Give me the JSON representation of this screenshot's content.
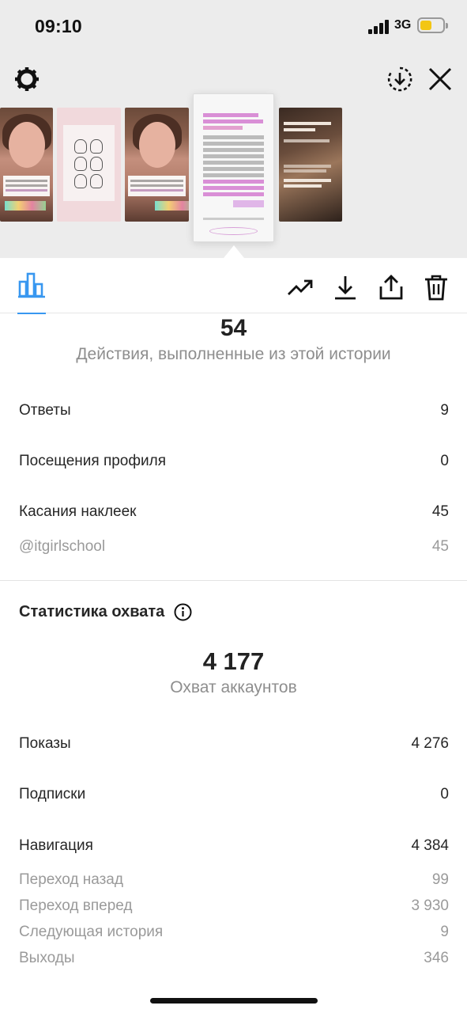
{
  "status_bar": {
    "time": "09:10",
    "network": "3G",
    "battery_level": 0.4,
    "battery_color": "#f3c614"
  },
  "top_bar": {
    "settings_icon": "gear-icon",
    "save_icon": "download-circle-icon",
    "close_icon": "close-icon"
  },
  "story_strip": {
    "selected_index": 3,
    "thumbnails": [
      {
        "kind": "face-photo"
      },
      {
        "kind": "drawings"
      },
      {
        "kind": "face-photo"
      },
      {
        "kind": "programming-text",
        "selected": true
      },
      {
        "kind": "dark-photo"
      }
    ]
  },
  "toolbar": {
    "active_tab_icon": "bar-chart-icon",
    "accent_color": "#3897f0",
    "actions": [
      "trending-up-icon",
      "download-icon",
      "share-icon",
      "trash-icon"
    ]
  },
  "interactions": {
    "total": "54",
    "total_label": "Действия, выполненные из этой истории",
    "rows": [
      {
        "label": "Ответы",
        "value": "9"
      },
      {
        "label": "Посещения профиля",
        "value": "0"
      },
      {
        "label": "Касания наклеек",
        "value": "45"
      }
    ],
    "sticker_rows": [
      {
        "label": "@itgirlschool",
        "value": "45"
      }
    ]
  },
  "reach": {
    "section_title": "Статистика охвата",
    "total": "4 177",
    "total_label": "Охват аккаунтов",
    "rows": [
      {
        "label": "Показы",
        "value": "4 276"
      },
      {
        "label": "Подписки",
        "value": "0"
      },
      {
        "label": "Навигация",
        "value": "4 384"
      }
    ],
    "navigation_rows": [
      {
        "label": "Переход назад",
        "value": "99"
      },
      {
        "label": "Переход вперед",
        "value": "3 930"
      },
      {
        "label": "Следующая история",
        "value": "9"
      },
      {
        "label": "Выходы",
        "value": "346"
      }
    ]
  }
}
